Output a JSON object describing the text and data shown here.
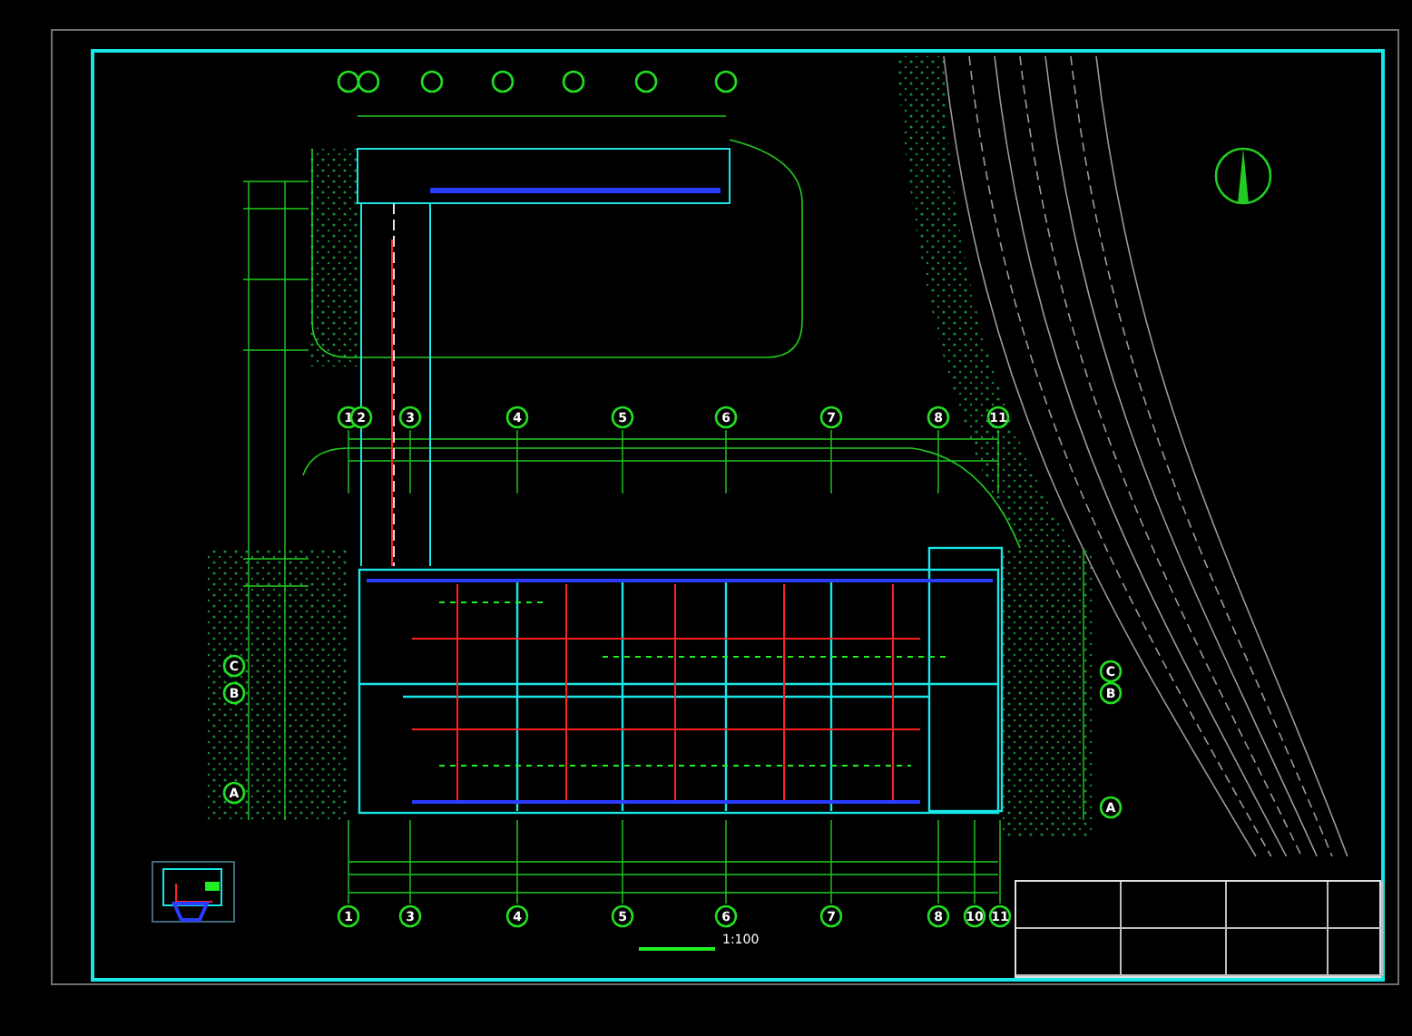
{
  "plan": {
    "top_axes": [
      "1",
      "2",
      "3",
      "4",
      "5",
      "6",
      "7",
      "8",
      "11"
    ],
    "bottom_axes": [
      "1",
      "3",
      "4",
      "5",
      "6",
      "7",
      "8",
      "10",
      "11"
    ],
    "left_axes": [
      "C",
      "B",
      "A"
    ],
    "right_axes": [
      "C",
      "B",
      "A"
    ],
    "scale": "1:100"
  }
}
